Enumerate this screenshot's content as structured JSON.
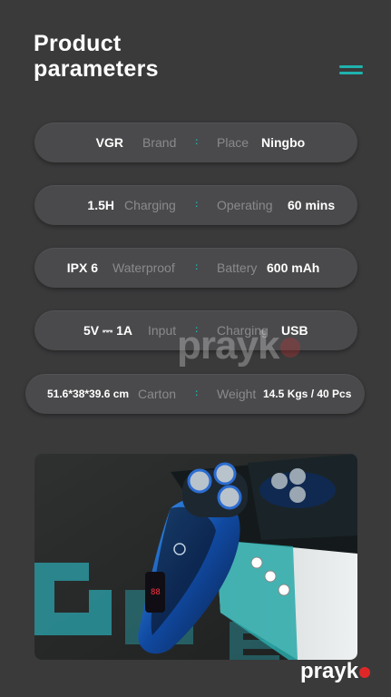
{
  "header": {
    "title_line1": "Product",
    "title_line2": "parameters",
    "menu_icon": "hamburger-icon",
    "accent_color": "#1fb3ad"
  },
  "rows": [
    {
      "left_value": "VGR",
      "left_label": "Brand",
      "separator": ":",
      "right_label": "Place",
      "right_value": "Ningbo"
    },
    {
      "left_value": "1.5H",
      "left_label": "Charging",
      "separator": ":",
      "right_label": "Operating",
      "right_value": "60 mins"
    },
    {
      "left_value": "IPX 6",
      "left_label": "Waterproof",
      "separator": ":",
      "right_label": "Battery",
      "right_value": "600 mAh"
    },
    {
      "left_value": "5V ⎓ 1A",
      "left_label": "Input",
      "separator": ":",
      "right_label": "Charging",
      "right_value": "USB"
    },
    {
      "left_value": "51.6*38*39.6 cm",
      "left_label": "Carton",
      "separator": ":",
      "right_label": "Weight",
      "right_value": "14.5 Kgs / 40 Pcs"
    }
  ],
  "product_image": {
    "description_icon": "shaver-product-photo"
  },
  "watermark": {
    "text": "prayk",
    "dot_color": "#e02727"
  }
}
